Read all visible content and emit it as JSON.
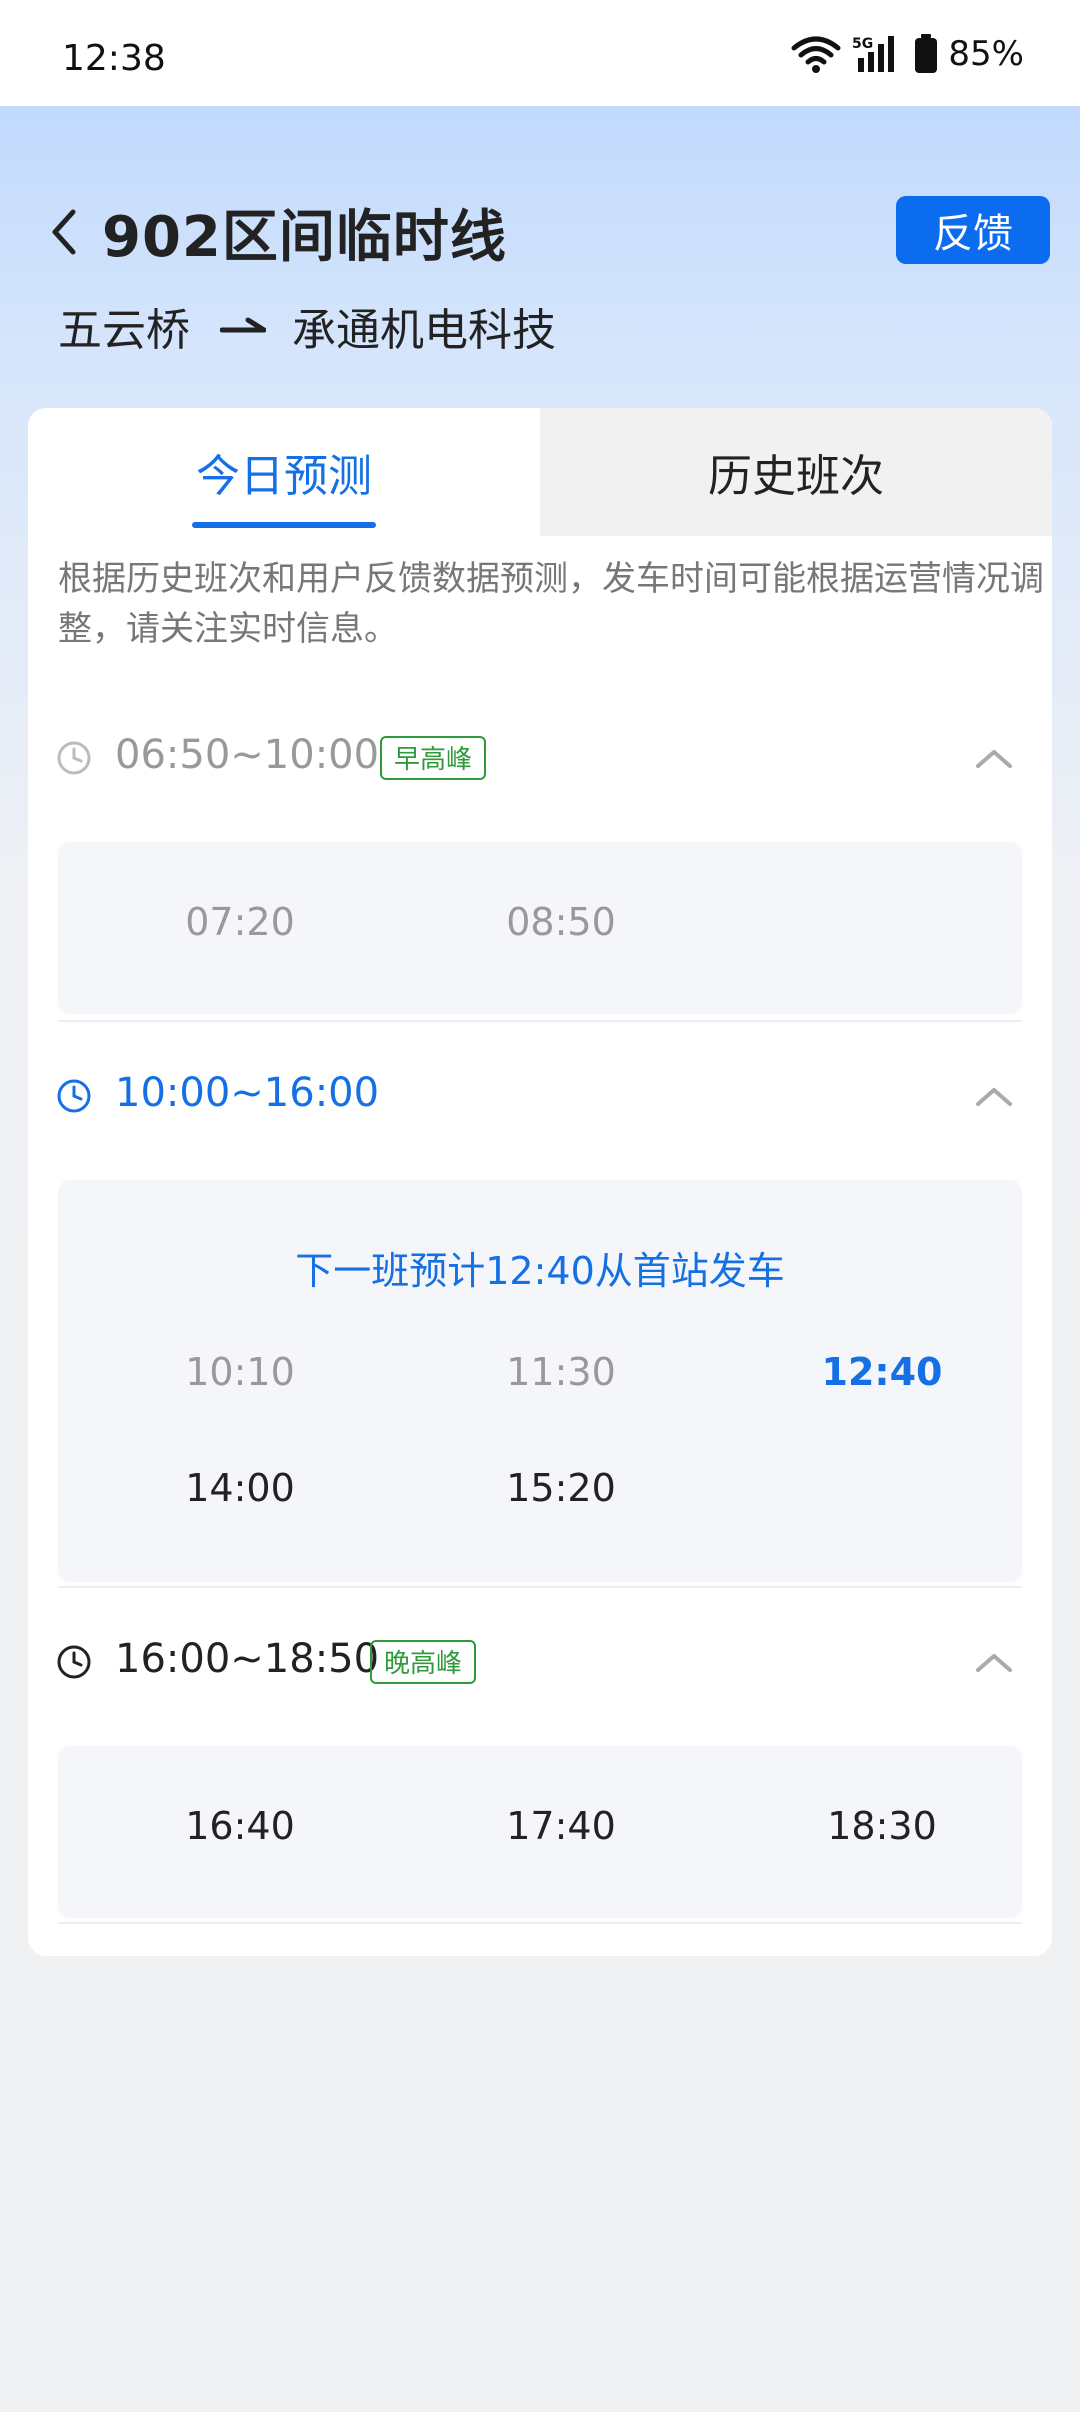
{
  "status_bar": {
    "time": "12:38",
    "network": "5G",
    "battery": "85%",
    "icons": [
      "wifi-icon",
      "signal-icon",
      "battery-icon"
    ]
  },
  "header": {
    "back_icon": "chevron-left-icon",
    "title": "902区间临时线",
    "feedback_label": "反馈",
    "from_stop": "五云桥",
    "to_stop": "承通机电科技",
    "direction_icon": "arrow-right-icon"
  },
  "tabs": [
    {
      "label": "今日预测",
      "active": true
    },
    {
      "label": "历史班次",
      "active": false
    }
  ],
  "notice": "根据历史班次和用户反馈数据预测，发车时间可能根据运营情况调整，请关注实时信息。",
  "sections": [
    {
      "range": "06:50~10:00",
      "tag": "早高峰",
      "state": "past",
      "times": [
        "07:20",
        "08:50"
      ]
    },
    {
      "range": "10:00~16:00",
      "tag": "",
      "state": "current",
      "next_message": "下一班预计12:40从首站发车",
      "times": [
        "10:10",
        "11:30",
        "12:40",
        "14:00",
        "15:20"
      ],
      "past_times": [
        "10:10",
        "11:30"
      ],
      "next_time": "12:40"
    },
    {
      "range": "16:00~18:50",
      "tag": "晚高峰",
      "state": "upcoming",
      "times": [
        "16:40",
        "17:40",
        "18:30"
      ]
    }
  ],
  "colors": {
    "accent": "#1570e6",
    "feedback_button": "#0b6cf0",
    "tag_green": "#2f9a3c",
    "past_text": "#999999"
  }
}
